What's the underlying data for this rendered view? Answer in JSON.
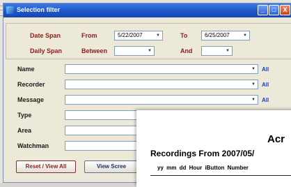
{
  "window": {
    "title": "Selection filter",
    "buttons": [
      "_",
      "□",
      "X"
    ]
  },
  "date_span": {
    "label": "Date Span",
    "from_label": "From",
    "from_value": "5/22/2007",
    "to_label": "To",
    "to_value": "6/25/2007"
  },
  "daily_span": {
    "label": "Daily Span",
    "between_label": "Between",
    "between_value": "",
    "and_label": "And",
    "and_value": ""
  },
  "fields": [
    {
      "label": "Name",
      "value": "",
      "all": "All",
      "dropdown": true
    },
    {
      "label": "Recorder",
      "value": "",
      "all": "All",
      "dropdown": true
    },
    {
      "label": "Message",
      "value": "",
      "all": "All",
      "dropdown": true
    },
    {
      "label": "Type",
      "value": ""
    },
    {
      "label": "Area",
      "value": ""
    },
    {
      "label": "Watchman",
      "value": ""
    }
  ],
  "buttons": {
    "reset": "Reset / View All",
    "view_screen": "View Scree"
  },
  "report": {
    "company": "Acr",
    "heading": "Recordings From 2007/05/",
    "columns": "yy  mm  dd  Hour  iButton  Number"
  },
  "colors": {
    "titlebar": "#2a5fd6",
    "label_red": "#8a1e1e",
    "all_link": "#1a3fbf",
    "dialog_bg": "#ece9d8"
  }
}
